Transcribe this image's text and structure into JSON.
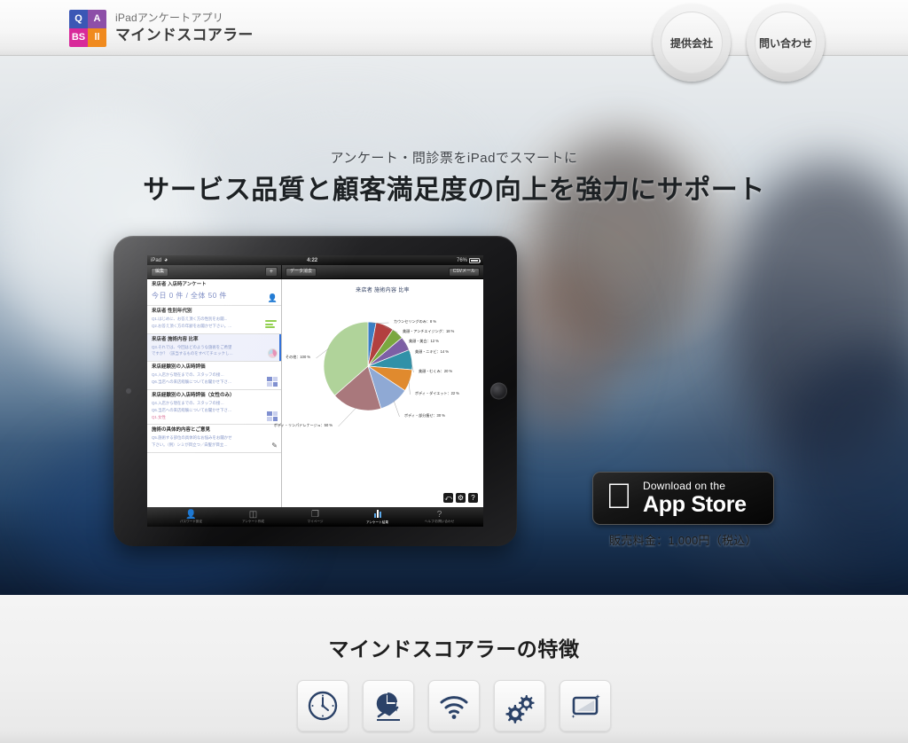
{
  "header": {
    "logo": {
      "sub": "iPadアンケートアプリ",
      "main": "マインドスコアラー",
      "tiles": [
        "Q",
        "A",
        "BS",
        "ll"
      ]
    },
    "nav": [
      {
        "label": "提供会社",
        "name": "provider-company"
      },
      {
        "label": "問い合わせ",
        "name": "contact"
      }
    ]
  },
  "hero": {
    "subtitle": "アンケート・問診票をiPadでスマートに",
    "title": "サービス品質と顧客満足度の向上を強力にサポート"
  },
  "ipad": {
    "status": {
      "carrier": "iPad",
      "wifi": "wifi-icon",
      "time": "4:22",
      "battery": "76%"
    },
    "toolbar": {
      "edit": "編集",
      "add": "+",
      "clear_data": "データ消去",
      "csv_mail": "CSVメール"
    },
    "list": [
      {
        "title": "来店者 入店時アンケート",
        "count": "今日 0 件 / 全体 50 件",
        "icon": "person-icon",
        "selected": false
      },
      {
        "title": "来店者 性別年代別",
        "q1": "Q1.はじめに、お答え頂く方の性別をお聞...",
        "q2": "Q2.お答え頂く方の年齢をお聞かせ下さい。…",
        "icon": "bars-icon",
        "selected": false
      },
      {
        "title": "来店者 施術内容 比率",
        "q1": "Q3.それでは、今回はどのような施術をご希望",
        "q2": "ですか？（該当するものをすべてチェックし…",
        "icon": "pie-icon",
        "selected": true
      },
      {
        "title": "来店経験別の入店時評価",
        "q1": "Q4.入店から現在までの、スタッフの接…",
        "q2": "Q6.当店への来店経験についてお聞かせ下さ…",
        "icon": "grid-icon",
        "selected": false
      },
      {
        "title": "来店経験別の入店時評価（女性のみ）",
        "q1": "Q4.入店から現在までの、スタッフの接…",
        "q2": "Q6.当店への来店経験についてお聞かせ下さ…",
        "q3": "Q1.女性",
        "icon": "grid-icon",
        "selected": false
      },
      {
        "title": "施術の具体的内容とご意見",
        "q1": "Q5.施術する部位の具体的なお悩みをお聞かせ",
        "q2": "下さい。（例）シミが目立つ／白髪が目立…",
        "icon": "pen-icon",
        "selected": false
      }
    ],
    "corner_buttons": [
      {
        "name": "undo-button",
        "glyph": "⤺"
      },
      {
        "name": "settings-gear-button",
        "glyph": "⚙"
      },
      {
        "name": "help-button",
        "glyph": "?"
      }
    ],
    "tabs": [
      {
        "label": "パスワード設定",
        "icon": "person-icon",
        "active": false
      },
      {
        "label": "アンケート作成",
        "icon": "form-icon",
        "active": false
      },
      {
        "label": "マイページ",
        "icon": "pages-icon",
        "active": false
      },
      {
        "label": "アンケート結果",
        "icon": "bar-chart-icon",
        "active": true
      },
      {
        "label": "ヘルプ/お問い合わせ",
        "icon": "question-icon",
        "active": false
      }
    ]
  },
  "chart_data": {
    "type": "pie",
    "title": "来店者 施術内容 比率",
    "categories": [
      "カウンセリングのみ",
      "美顔・アンチエイジング",
      "美顔・美白",
      "美顔・ニキビ",
      "美顔・むくみ",
      "ボディ・ダイエット",
      "ボディ・部分痩せ",
      "ボディ・リンパドレナージュ",
      "その他"
    ],
    "values": [
      8,
      18,
      12,
      14,
      20,
      22,
      30,
      50,
      100
    ],
    "labels": [
      "カウンセリングのみ：8 %",
      "美顔・アンチエイジング：18 %",
      "美顔・美白：12 %",
      "美顔・ニキビ：14 %",
      "美顔・むくみ：20 %",
      "ボディ・ダイエット：22 %",
      "ボディ・部分痩せ：30 %",
      "ボディ・リンパドレナージュ：50 %",
      "その他：100 %"
    ],
    "colors": [
      "#3b7fc4",
      "#b2403f",
      "#7aa83f",
      "#7d5fa5",
      "#3191a8",
      "#e08a2e",
      "#8fa9d4",
      "#a9787c",
      "#b0d39a"
    ],
    "legend": "none",
    "grid": false,
    "unit": "%"
  },
  "appstore": {
    "small_label": "Download on the",
    "big_label": "App Store",
    "apple_icon": "apple-logo-icon",
    "price": "販売料金：1,000円（税込）"
  },
  "features": {
    "title": "マインドスコアラーの特徴",
    "icons": [
      {
        "name": "clock-icon"
      },
      {
        "name": "pie-chart-trend-icon"
      },
      {
        "name": "wifi-icon"
      },
      {
        "name": "gears-icon"
      },
      {
        "name": "tablet-screen-icon"
      }
    ]
  },
  "colors": {
    "accent_blue": "#2f6fd8",
    "header_bg": "#f4f4f4",
    "hero_dark": "#0d1c33"
  }
}
